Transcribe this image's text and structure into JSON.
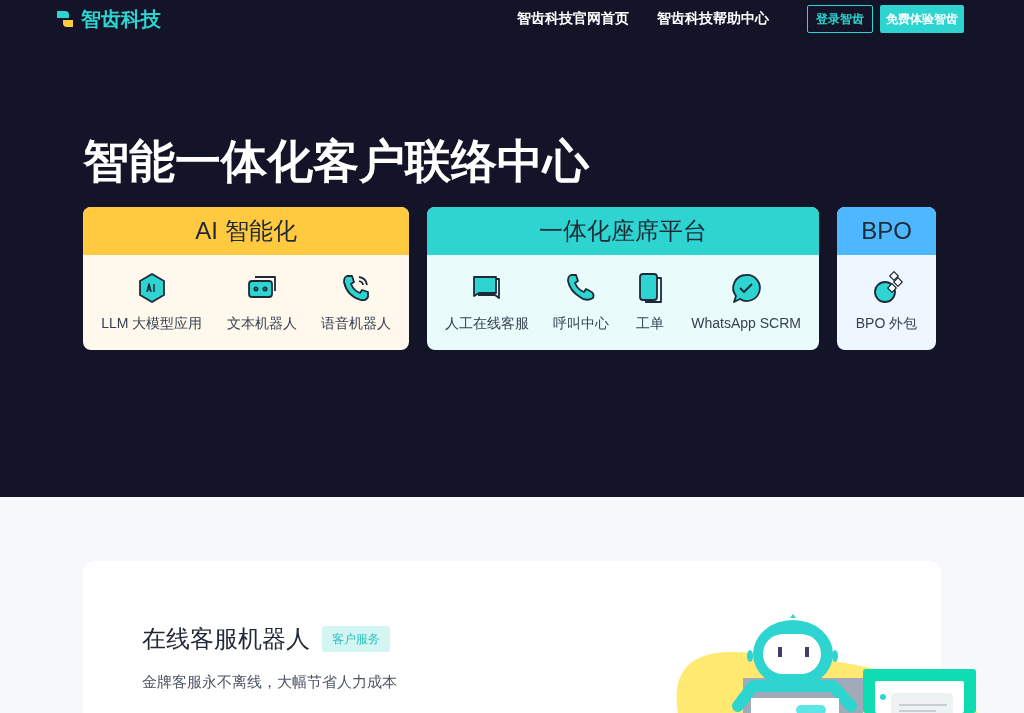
{
  "nav": {
    "logo": "智齿科技",
    "links": [
      "智齿科技官网首页",
      "智齿科技帮助中心"
    ],
    "login_button": "登录智齿",
    "trial_button": "免费体验智齿"
  },
  "hero": {
    "title": "智能一体化客户联络中心",
    "categories": [
      {
        "title": "AI 智能化",
        "color": "#ffc940",
        "items": [
          "LLM 大模型应用",
          "文本机器人",
          "语音机器人"
        ]
      },
      {
        "title": "一体化座席平台",
        "color": "#2dd4d0",
        "items": [
          "人工在线客服",
          "呼叫中心",
          "工单",
          "WhatsApp SCRM"
        ]
      },
      {
        "title": "BPO",
        "color": "#4db8ff",
        "items": [
          "BPO 外包"
        ]
      }
    ]
  },
  "feature": {
    "title": "在线客服机器人",
    "tag": "客户服务",
    "subtitle": "金牌客服永不离线，大幅节省人力成本"
  }
}
